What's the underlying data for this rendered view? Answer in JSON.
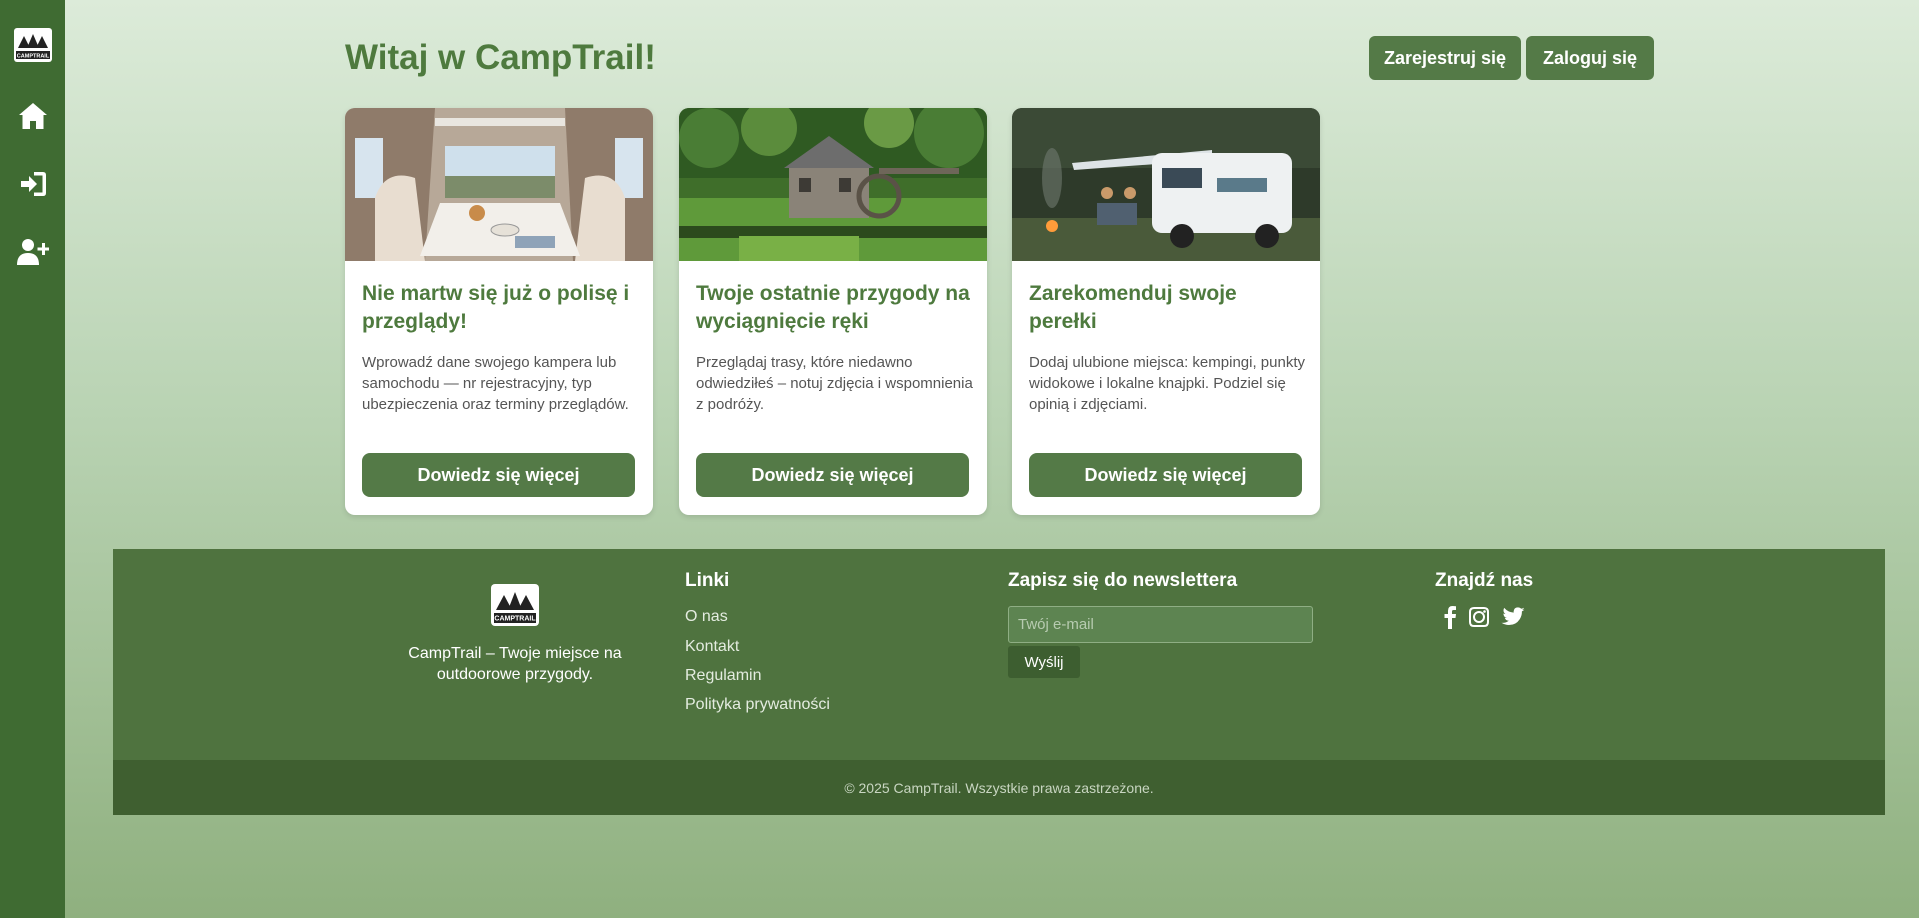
{
  "sidebar": {
    "logo_text": "CAMPTRAIL",
    "items": [
      {
        "icon": "home-icon"
      },
      {
        "icon": "sign-in-icon"
      },
      {
        "icon": "user-plus-icon"
      }
    ]
  },
  "header": {
    "title": "Witaj w CampTrail!",
    "register_label": "Zarejestruj się",
    "login_label": "Zaloguj się"
  },
  "cards": [
    {
      "image": "camper-interior-photo",
      "title": "Nie martw się już o polisę i przeglądy!",
      "text": "Wprowadź dane swojego kampera lub samochodu — nr rejestracyjny, typ ubezpieczenia oraz terminy przeglądów.",
      "button": "Dowiedz się więcej"
    },
    {
      "image": "watermill-landscape-photo",
      "title": "Twoje ostatnie przygody na wyciągnięcie ręki",
      "text": "Przeglądaj trasy, które niedawno odwiedziłeś – notuj zdjęcia i wspomnienia z podróży.",
      "button": "Dowiedz się więcej"
    },
    {
      "image": "camper-campfire-photo",
      "title": "Zarekomenduj swoje perełki",
      "text": "Dodaj ulubione miejsca: kempingi, punkty widokowe i lokalne knajpki. Podziel się opinią i zdjęciami.",
      "button": "Dowiedz się więcej"
    }
  ],
  "footer": {
    "logo_text": "CAMPTRAIL",
    "tagline": "CampTrail – Twoje miejsce na outdoorowe przygody.",
    "links_heading": "Linki",
    "links": [
      "O nas",
      "Kontakt",
      "Regulamin",
      "Polityka prywatności"
    ],
    "newsletter_heading": "Zapisz się do newslettera",
    "newsletter_placeholder": "Twój e-mail",
    "newsletter_button": "Wyślij",
    "social_heading": "Znajdź nas",
    "social": [
      "facebook-icon",
      "instagram-icon",
      "twitter-icon"
    ],
    "copyright": "© 2025 CampTrail. Wszystkie prawa zastrzeżone."
  },
  "colors": {
    "sidebar": "#3f6b32",
    "accent": "#547a47",
    "title": "#4e7a3e",
    "footer": "#4f733f",
    "footer_bottom": "#3f5f30"
  }
}
